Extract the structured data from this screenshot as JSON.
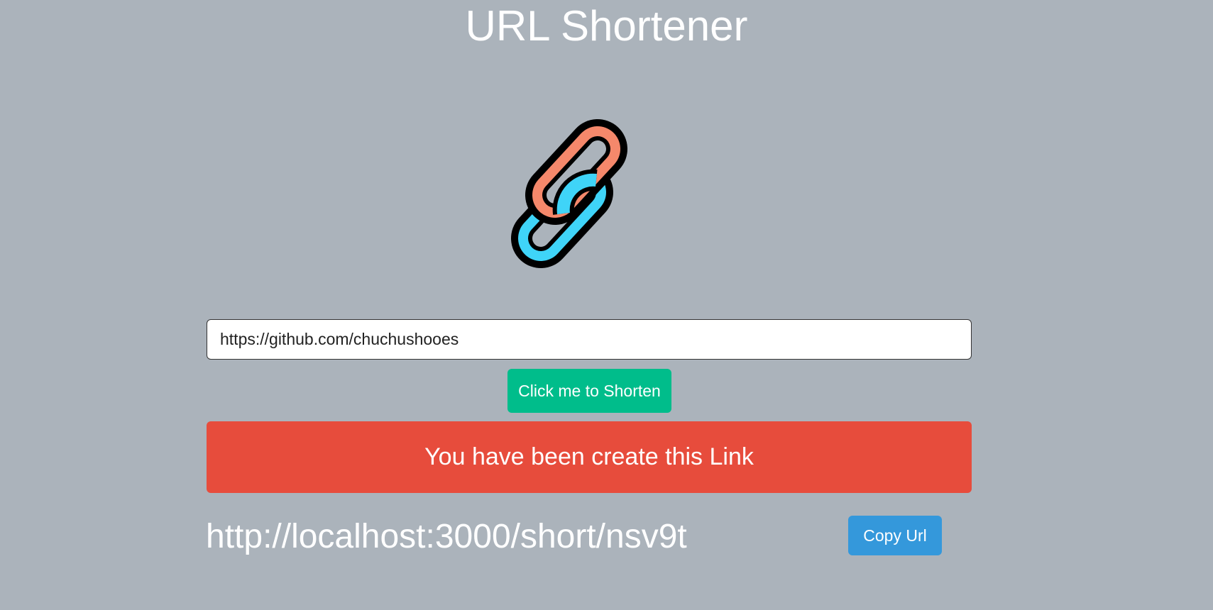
{
  "header": {
    "title": "URL Shortener"
  },
  "logo": {
    "icon": "chain-link-icon",
    "colors": {
      "link_orange": "#f5886b",
      "link_blue": "#3fd4f8",
      "outline": "#000000"
    }
  },
  "form": {
    "url_value": "https://github.com/chuchushooes",
    "shorten_label": "Click me to Shorten"
  },
  "result": {
    "banner_text": "You have been create this Link",
    "short_url": "http://localhost:3000/short/nsv9t",
    "copy_label": "Copy Url"
  },
  "colors": {
    "background": "#abb3bb",
    "shorten_button": "#00bd8b",
    "banner": "#e74c3c",
    "copy_button": "#3498db"
  }
}
